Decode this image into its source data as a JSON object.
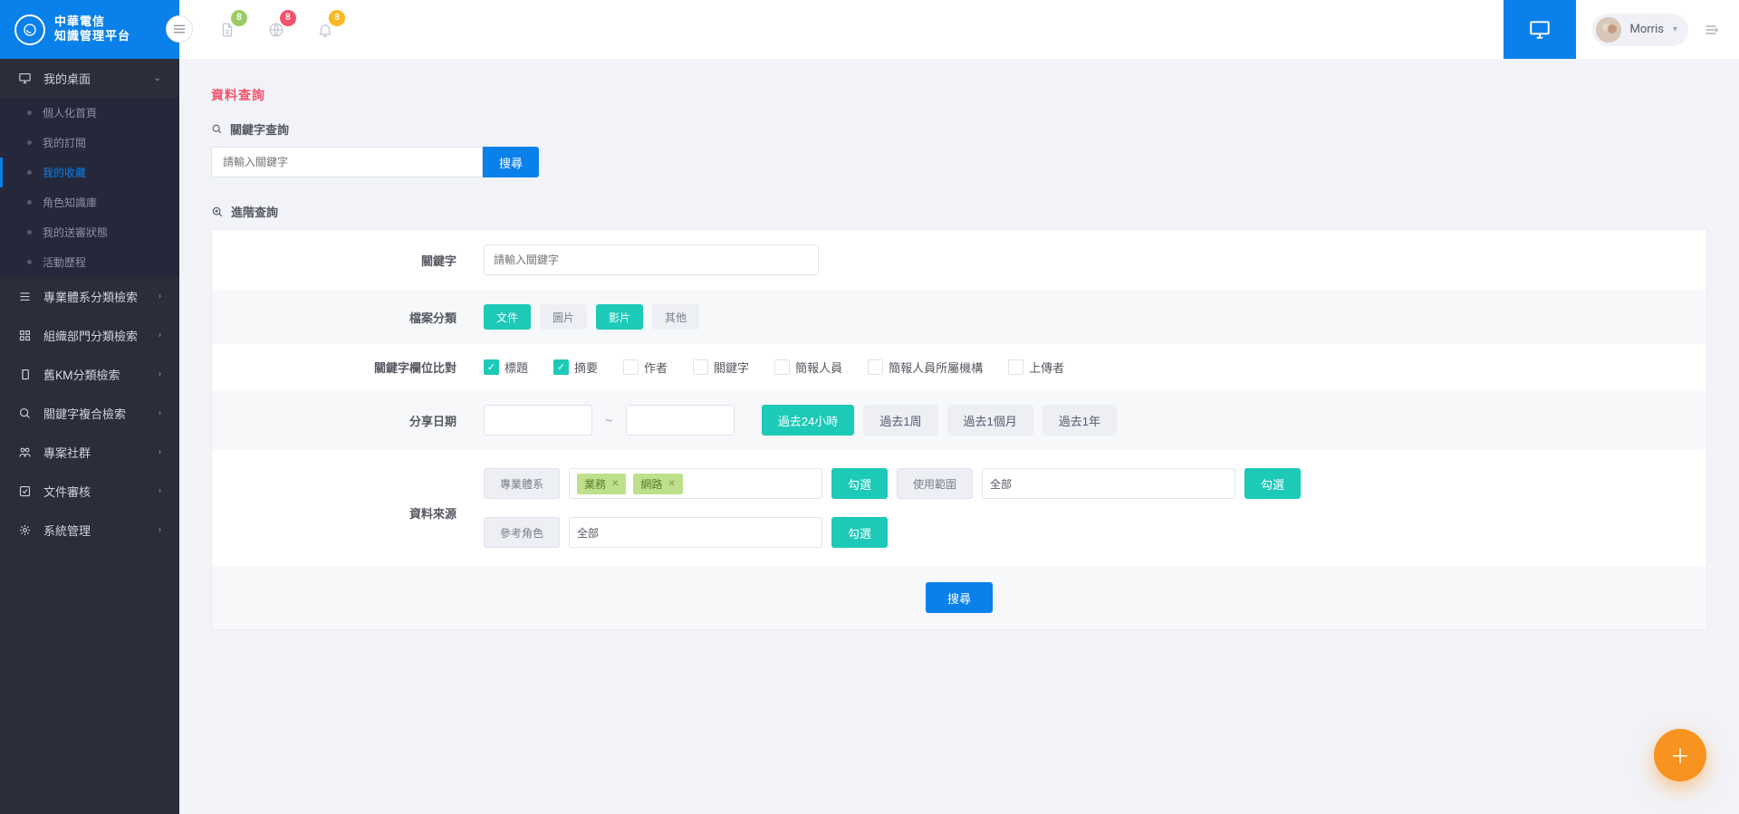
{
  "brand": {
    "line1": "中華電信",
    "line2": "知識管理平台"
  },
  "header_badges": {
    "doc": "8",
    "globe": "8",
    "bell": "8"
  },
  "user": {
    "name": "Morris"
  },
  "sidebar": {
    "desktop": {
      "label": "我的桌面",
      "items": [
        "個人化首頁",
        "我的訂閱",
        "我的收藏",
        "角色知識庫",
        "我的送審狀態",
        "活動歷程"
      ],
      "active_index": 2
    },
    "groups": [
      "專業體系分類檢索",
      "組織部門分類檢索",
      "舊KM分類檢索",
      "關鍵字複合檢索",
      "專案社群",
      "文件審核",
      "系統管理"
    ]
  },
  "page_title": "資料查詢",
  "keyword": {
    "label": "關鍵字查詢",
    "placeholder": "請輸入關鍵字",
    "button": "搜尋"
  },
  "advanced": {
    "label": "進階查詢",
    "rows": {
      "keyword": {
        "label": "關鍵字",
        "placeholder": "請輸入關鍵字"
      },
      "fileType": {
        "label": "檔案分類",
        "options": [
          "文件",
          "圖片",
          "影片",
          "其他"
        ],
        "selected": [
          0,
          2
        ]
      },
      "matchFields": {
        "label": "關鍵字欄位比對",
        "options": [
          "標題",
          "摘要",
          "作者",
          "關鍵字",
          "簡報人員",
          "簡報人員所屬機構",
          "上傳者"
        ],
        "checked": [
          0,
          1
        ]
      },
      "shareDate": {
        "label": "分享日期",
        "ranges": [
          "過去24小時",
          "過去1周",
          "過去1個月",
          "過去1年"
        ],
        "selected": 0
      },
      "dataSource": {
        "label": "資料來源",
        "choose_button": "勾選",
        "rows": [
          {
            "label": "專業體系",
            "tags": [
              "業務",
              "網路"
            ]
          },
          {
            "label": "使用範圍",
            "value": "全部"
          },
          {
            "label": "參考角色",
            "value": "全部"
          }
        ]
      }
    },
    "submit": "搜尋"
  }
}
